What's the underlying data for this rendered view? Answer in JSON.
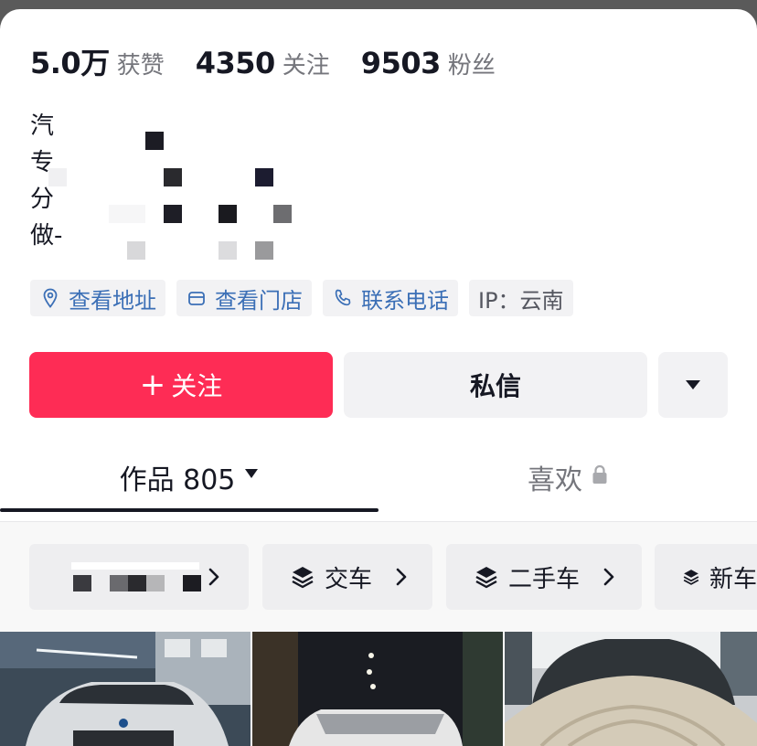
{
  "stats": [
    {
      "number": "5.0万",
      "label": "获赞"
    },
    {
      "number": "4350",
      "label": "关注"
    },
    {
      "number": "9503",
      "label": "粉丝"
    }
  ],
  "bio": {
    "lines": [
      "汽",
      "专",
      "分",
      "做-"
    ]
  },
  "chips": [
    {
      "icon": "location-pin-icon",
      "label": "查看地址",
      "style": "link"
    },
    {
      "icon": "store-icon",
      "label": "查看门店",
      "style": "link"
    },
    {
      "icon": "phone-icon",
      "label": "联系电话",
      "style": "link"
    },
    {
      "icon": "",
      "label": "IP：云南",
      "style": "plain"
    }
  ],
  "actions": {
    "follow_plus": "+",
    "follow_label": "关注",
    "message_label": "私信",
    "more_icon": "caret-down-icon"
  },
  "tabs": {
    "works_label": "作品 805",
    "likes_label": "喜欢",
    "likes_icon": "lock-icon"
  },
  "collections": [
    {
      "label": "",
      "icon": "",
      "redacted": true
    },
    {
      "label": "交车",
      "icon": "layers-icon"
    },
    {
      "label": "二手车",
      "icon": "layers-icon"
    },
    {
      "label": "新车",
      "icon": "layers-icon"
    }
  ],
  "colors": {
    "accent": "#fe2c55",
    "link": "#3b6fb6",
    "chip_bg": "#f2f2f4",
    "text_primary": "#161823",
    "text_secondary": "#75767c"
  }
}
